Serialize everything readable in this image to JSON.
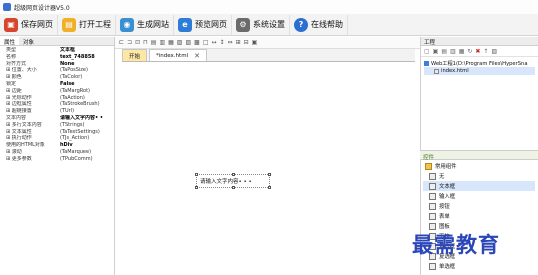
{
  "window": {
    "title": "超级网页设计器V5.0"
  },
  "toolbar": {
    "save": "保存网页",
    "open_project": "打开工程",
    "generate_site": "生成网站",
    "preview": "预览网页",
    "settings": "系统设置",
    "help": "在线帮助"
  },
  "left_panel": {
    "tabs": [
      "属性",
      "对象"
    ],
    "properties": [
      {
        "name": "类型",
        "value": "文本框",
        "bold": true
      },
      {
        "name": "名称",
        "value": "text_748858",
        "bold": true
      },
      {
        "name": "对齐方式",
        "value": "None",
        "bold": true
      },
      {
        "name": "⊞ 位置、大小",
        "value": "(TaPosSize)"
      },
      {
        "name": "⊞ 颜色",
        "value": "(TaColor)"
      },
      {
        "name": "锁定",
        "value": "False",
        "bold": true
      },
      {
        "name": "⊞ 边距",
        "value": "(TaMargRot)"
      },
      {
        "name": "⊞ 光标动作",
        "value": "(TaAction)"
      },
      {
        "name": "⊞ 边框属性",
        "value": "(TaStrokeBrush)"
      },
      {
        "name": "⊞ 超链接置",
        "value": "(TUrl)"
      },
      {
        "name": "文本内容",
        "value": "请输入文字内容• •",
        "bold": true
      },
      {
        "name": "⊞ 多行文本内容",
        "value": "(TStrings)"
      },
      {
        "name": "⊞ 文本属性",
        "value": "(TaTextSettings)"
      },
      {
        "name": "⊞ 执行动作",
        "value": "(TJs_Action)"
      },
      {
        "name": "使用的HTML对象",
        "value": "hDiv",
        "bold": true
      },
      {
        "name": "⊞ 滚动",
        "value": "(TaMarquee)"
      },
      {
        "name": "⊞ 更多参数",
        "value": "(TPubComm)"
      }
    ]
  },
  "editor": {
    "tabs": [
      "开始",
      "*index.html"
    ],
    "close_glyph": "✕",
    "text_box_content": "请输入文字内容• • •"
  },
  "right_panel": {
    "title": "工程",
    "tree": [
      {
        "label": "Web工程1(D:\\Program Files\\HyperSna"
      },
      {
        "label": "index.html"
      }
    ],
    "components_title": "控件",
    "components": [
      {
        "label": "常用组件",
        "group": true
      },
      {
        "label": "无"
      },
      {
        "label": "文本框",
        "selected": true
      },
      {
        "label": "输入框"
      },
      {
        "label": "按钮"
      },
      {
        "label": "表单"
      },
      {
        "label": "图板"
      },
      {
        "label": "下拉"
      },
      {
        "label": "复选框"
      },
      {
        "label": "复选框"
      },
      {
        "label": "单选框"
      }
    ]
  },
  "watermark": "最需教育",
  "colors": {
    "save_icon": "#d8452f",
    "open_icon": "#f0b02a",
    "generate_icon": "#3a8fd1",
    "preview_icon": "#2e7bd8",
    "settings_icon": "#6b6b6b",
    "help_icon": "#2b6fd3",
    "watermark": "#2b46b8"
  }
}
